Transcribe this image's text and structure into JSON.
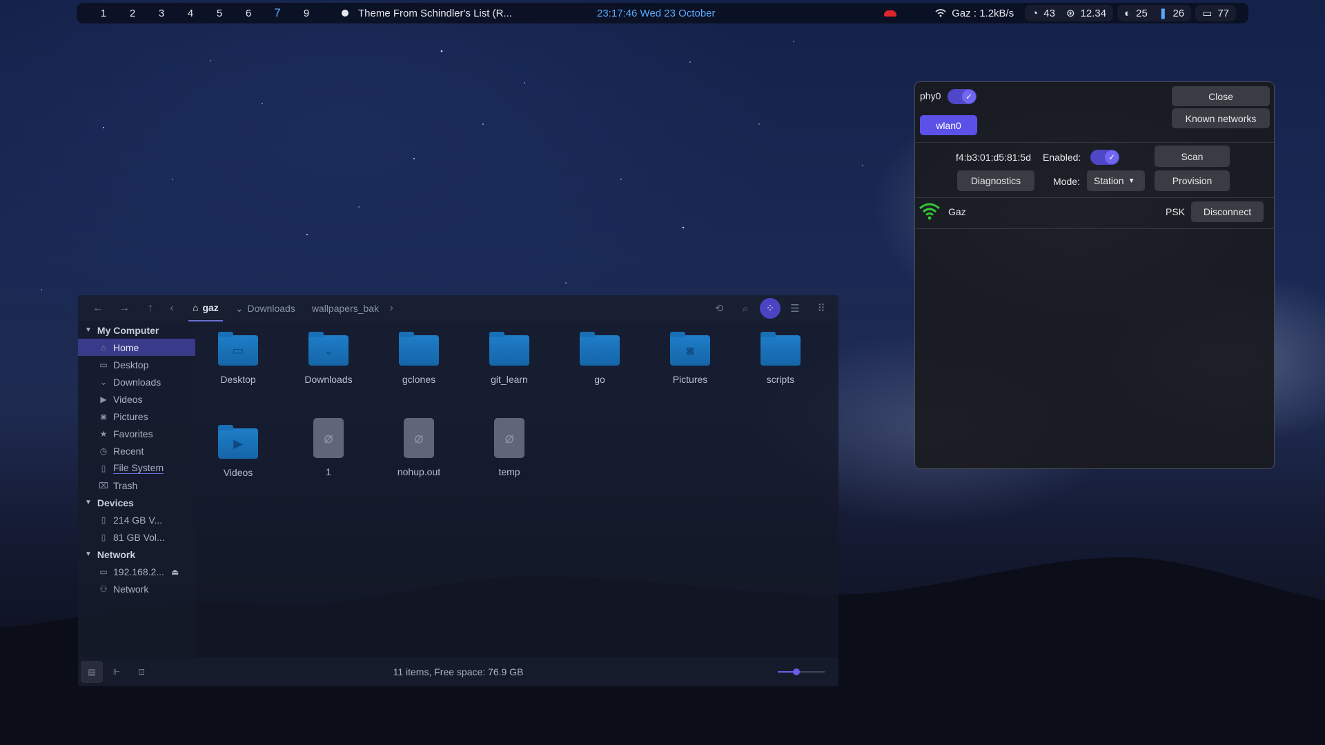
{
  "topbar": {
    "workspaces": [
      "1",
      "2",
      "3",
      "4",
      "5",
      "6",
      "7",
      "9"
    ],
    "active_workspace": "7",
    "media_title": "Theme From Schindler's List (R...",
    "clock": "23:17:46  Wed 23 October",
    "wifi": "Gaz : 1.2kB/s",
    "cpu": "43",
    "load": "12.34",
    "brightness": "25",
    "temperature": "26",
    "battery": "77"
  },
  "file_manager": {
    "breadcrumbs": [
      "gaz",
      "Downloads",
      "wallpapers_bak"
    ],
    "sidebar": {
      "my_computer": "My Computer",
      "places": [
        "Home",
        "Desktop",
        "Downloads",
        "Videos",
        "Pictures",
        "Favorites",
        "Recent",
        "File System",
        "Trash"
      ],
      "devices_header": "Devices",
      "devices": [
        "214 GB V...",
        "81 GB Vol..."
      ],
      "network_header": "Network",
      "network": [
        "192.168.2...",
        "Network"
      ]
    },
    "items": [
      {
        "name": "Desktop",
        "kind": "folder",
        "glyph": "▭"
      },
      {
        "name": "Downloads",
        "kind": "folder",
        "glyph": "⌄"
      },
      {
        "name": "gclones",
        "kind": "folder",
        "glyph": ""
      },
      {
        "name": "git_learn",
        "kind": "folder",
        "glyph": ""
      },
      {
        "name": "go",
        "kind": "folder",
        "glyph": ""
      },
      {
        "name": "Pictures",
        "kind": "folder",
        "glyph": "◙"
      },
      {
        "name": "scripts",
        "kind": "folder",
        "glyph": ""
      },
      {
        "name": "Videos",
        "kind": "folder",
        "glyph": "▶"
      },
      {
        "name": "1",
        "kind": "file",
        "glyph": "⌀"
      },
      {
        "name": "nohup.out",
        "kind": "file",
        "glyph": "⌀"
      },
      {
        "name": "temp",
        "kind": "file",
        "glyph": "⌀"
      }
    ],
    "status": "11 items, Free space: 76.9 GB",
    "zoom_level": 0.4
  },
  "network_window": {
    "phy": "phy0",
    "interface": "wlan0",
    "close": "Close",
    "known_networks": "Known networks",
    "mac": "f4:b3:01:d5:81:5d",
    "enabled_label": "Enabled:",
    "scan": "Scan",
    "diagnostics": "Diagnostics",
    "mode_label": "Mode:",
    "mode_value": "Station",
    "provision": "Provision",
    "network_name": "Gaz",
    "security": "PSK",
    "disconnect": "Disconnect",
    "colors": {
      "accent": "#5b51e8",
      "wifi": "#33c833"
    }
  }
}
